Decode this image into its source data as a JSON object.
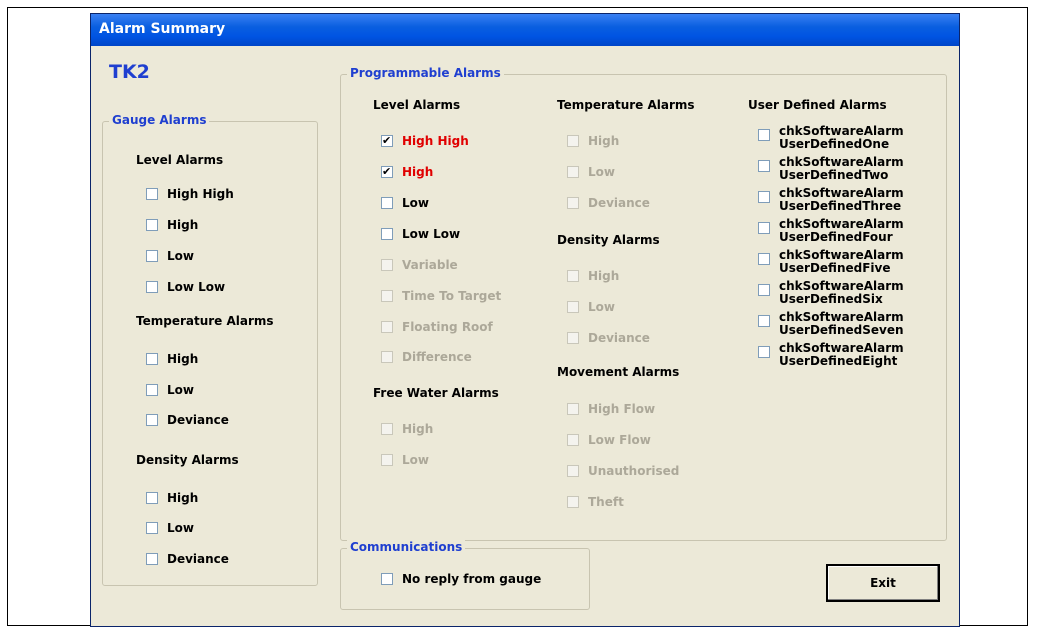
{
  "window": {
    "title": "Alarm Summary",
    "tank": "TK2"
  },
  "gauge_alarms": {
    "legend": "Gauge Alarms",
    "level_heading": "Level Alarms",
    "level": [
      {
        "label": "High High",
        "checked": false
      },
      {
        "label": "High",
        "checked": false
      },
      {
        "label": "Low",
        "checked": false
      },
      {
        "label": "Low Low",
        "checked": false
      }
    ],
    "temperature_heading": "Temperature Alarms",
    "temperature": [
      {
        "label": "High",
        "checked": false
      },
      {
        "label": "Low",
        "checked": false
      },
      {
        "label": "Deviance",
        "checked": false
      }
    ],
    "density_heading": "Density Alarms",
    "density": [
      {
        "label": "High",
        "checked": false
      },
      {
        "label": "Low",
        "checked": false
      },
      {
        "label": "Deviance",
        "checked": false
      }
    ]
  },
  "programmable_alarms": {
    "legend": "Programmable Alarms",
    "level_heading": "Level Alarms",
    "level": [
      {
        "label": "High High",
        "checked": true
      },
      {
        "label": "High",
        "checked": true
      },
      {
        "label": "Low",
        "checked": false
      },
      {
        "label": "Low Low",
        "checked": false
      },
      {
        "label": "Variable",
        "checked": false
      },
      {
        "label": "Time To Target",
        "checked": false
      },
      {
        "label": "Floating Roof",
        "checked": false
      },
      {
        "label": "Difference",
        "checked": false
      }
    ],
    "free_water_heading": "Free Water Alarms",
    "free_water": [
      {
        "label": "High",
        "checked": false
      },
      {
        "label": "Low",
        "checked": false
      }
    ],
    "temperature_heading": "Temperature Alarms",
    "temperature": [
      {
        "label": "High",
        "checked": false
      },
      {
        "label": "Low",
        "checked": false
      },
      {
        "label": "Deviance",
        "checked": false
      }
    ],
    "density_heading": "Density Alarms",
    "density": [
      {
        "label": "High",
        "checked": false
      },
      {
        "label": "Low",
        "checked": false
      },
      {
        "label": "Deviance",
        "checked": false
      }
    ],
    "movement_heading": "Movement Alarms",
    "movement": [
      {
        "label": "High Flow",
        "checked": false
      },
      {
        "label": "Low Flow",
        "checked": false
      },
      {
        "label": "Unauthorised",
        "checked": false
      },
      {
        "label": "Theft",
        "checked": false
      }
    ],
    "user_defined_heading": "User Defined Alarms",
    "user_defined": [
      {
        "line1": "chkSoftwareAlarm",
        "line2": "UserDefinedOne",
        "checked": false
      },
      {
        "line1": "chkSoftwareAlarm",
        "line2": "UserDefinedTwo",
        "checked": false
      },
      {
        "line1": "chkSoftwareAlarm",
        "line2": "UserDefinedThree",
        "checked": false
      },
      {
        "line1": "chkSoftwareAlarm",
        "line2": "UserDefinedFour",
        "checked": false
      },
      {
        "line1": "chkSoftwareAlarm",
        "line2": "UserDefinedFive",
        "checked": false
      },
      {
        "line1": "chkSoftwareAlarm",
        "line2": "UserDefinedSix",
        "checked": false
      },
      {
        "line1": "chkSoftwareAlarm",
        "line2": "UserDefinedSeven",
        "checked": false
      },
      {
        "line1": "chkSoftwareAlarm",
        "line2": "UserDefinedEight",
        "checked": false
      }
    ]
  },
  "communications": {
    "legend": "Communications",
    "items": [
      {
        "label": "No reply from gauge",
        "checked": false
      }
    ]
  },
  "buttons": {
    "exit": "Exit"
  },
  "colors": {
    "alarm_active": "#e00000",
    "legend_text": "#1f3fd0",
    "disabled_text": "#aca899"
  }
}
